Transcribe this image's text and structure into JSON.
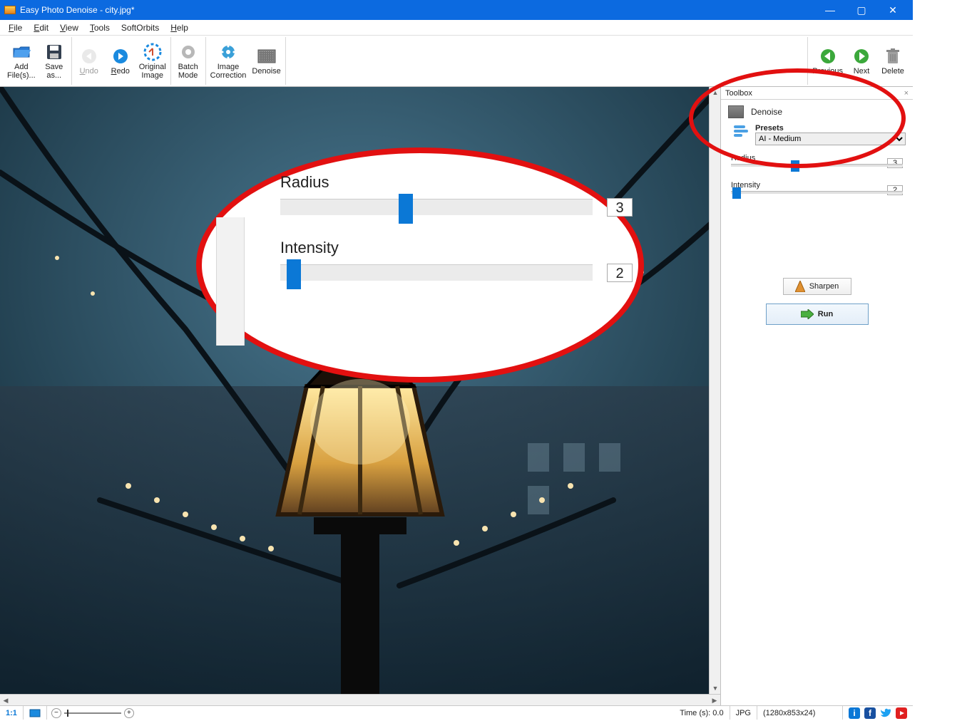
{
  "window": {
    "title": "Easy Photo Denoise - city.jpg*",
    "controls": {
      "min": "—",
      "max": "▢",
      "close": "✕"
    }
  },
  "menu": {
    "file": "File",
    "edit": "Edit",
    "view": "View",
    "tools": "Tools",
    "softorbits": "SoftOrbits",
    "help": "Help"
  },
  "toolbar": {
    "add_files": "Add\nFile(s)...",
    "save_as": "Save\nas...",
    "undo": "Undo",
    "redo": "Redo",
    "original": "Original\nImage",
    "batch": "Batch\nMode",
    "correction": "Image\nCorrection",
    "denoise": "Denoise",
    "previous": "Previous",
    "next": "Next",
    "delete": "Delete"
  },
  "toolbox": {
    "title": "Toolbox",
    "section_label": "Denoise",
    "presets_label": "Presets",
    "preset_selected": "AI - Medium",
    "radius": {
      "label": "Radius",
      "value": "3",
      "pos_pct": 35
    },
    "intensity": {
      "label": "Intensity",
      "value": "2",
      "pos_pct": 2
    },
    "sharpen_btn": "Sharpen",
    "run_btn": "Run"
  },
  "zoom_overlay": {
    "radius": {
      "label": "Radius",
      "value": "3",
      "pos_pct": 38
    },
    "intensity": {
      "label": "Intensity",
      "value": "2",
      "pos_pct": 2
    }
  },
  "status": {
    "zoom_label": "1:1",
    "time": "Time (s): 0.0",
    "format": "JPG",
    "dims": "(1280x853x24)"
  }
}
